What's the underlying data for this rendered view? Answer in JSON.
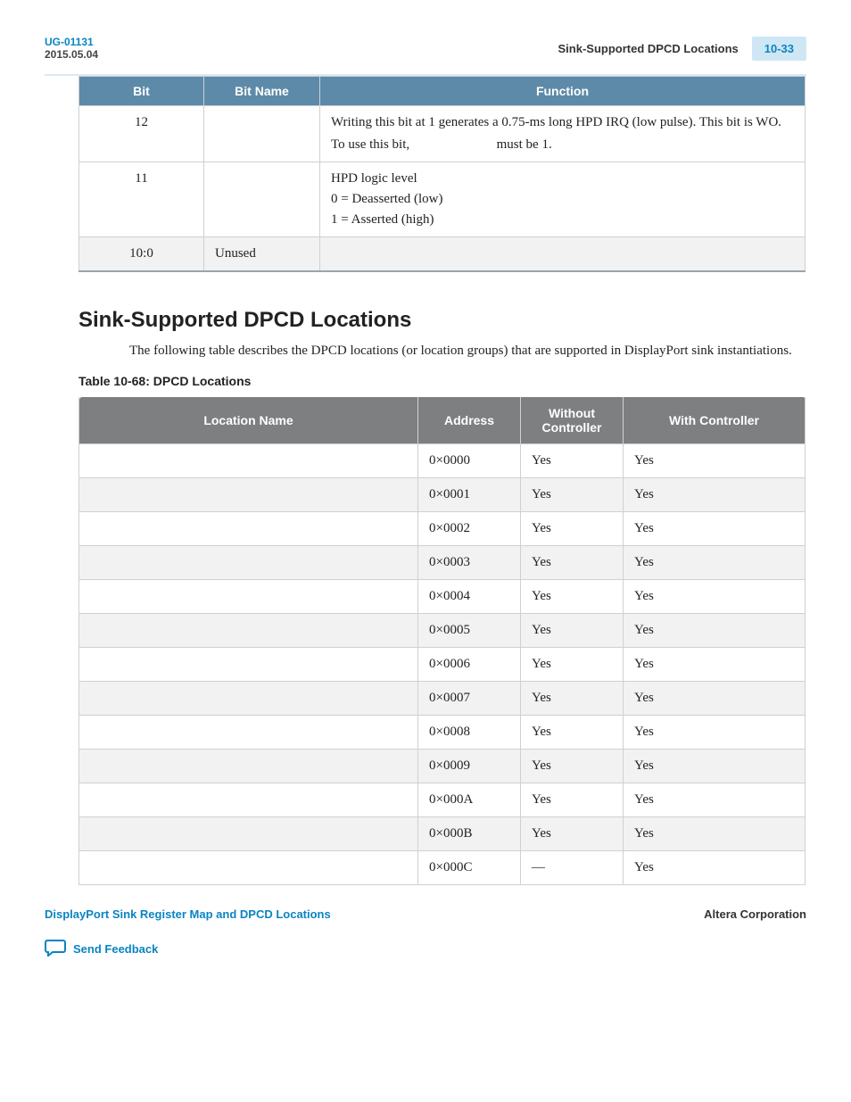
{
  "header": {
    "doc_id": "UG-01131",
    "doc_date": "2015.05.04",
    "section_title": "Sink-Supported DPCD Locations",
    "page_num": "10-33"
  },
  "table1": {
    "headers": {
      "c1": "Bit",
      "c2": "Bit Name",
      "c3": "Function"
    },
    "rows": [
      {
        "bit": "12",
        "name": "",
        "fn_l1": "Writing this bit at 1 generates a 0.75-ms long HPD IRQ (low pulse). This bit is WO.",
        "fn_l2a": "To use this bit,",
        "fn_l2b": "must be 1."
      },
      {
        "bit": "11",
        "name": "",
        "fn_l1": "HPD logic level",
        "fn_l2": "0 = Deasserted (low)",
        "fn_l3": "1 = Asserted (high)"
      },
      {
        "bit": "10:0",
        "name": "Unused",
        "fn": ""
      }
    ]
  },
  "section_heading": "Sink-Supported DPCD Locations",
  "intro_text": "The following table describes the DPCD locations (or location groups) that are supported in DisplayPort sink instantiations.",
  "table2_caption": "Table 10-68: DPCD Locations",
  "table2": {
    "headers": {
      "c1": "Location Name",
      "c2": "Address",
      "c3": "Without Controller",
      "c4": "With Controller"
    },
    "rows": [
      {
        "name": "",
        "addr": "0×0000",
        "wo": "Yes",
        "wc": "Yes"
      },
      {
        "name": "",
        "addr": "0×0001",
        "wo": "Yes",
        "wc": "Yes"
      },
      {
        "name": "",
        "addr": "0×0002",
        "wo": "Yes",
        "wc": "Yes"
      },
      {
        "name": "",
        "addr": "0×0003",
        "wo": "Yes",
        "wc": "Yes"
      },
      {
        "name": "",
        "addr": "0×0004",
        "wo": "Yes",
        "wc": "Yes"
      },
      {
        "name": "",
        "addr": "0×0005",
        "wo": "Yes",
        "wc": "Yes"
      },
      {
        "name": "",
        "addr": "0×0006",
        "wo": "Yes",
        "wc": "Yes"
      },
      {
        "name": "",
        "addr": "0×0007",
        "wo": "Yes",
        "wc": "Yes"
      },
      {
        "name": "",
        "addr": "0×0008",
        "wo": "Yes",
        "wc": "Yes"
      },
      {
        "name": "",
        "addr": "0×0009",
        "wo": "Yes",
        "wc": "Yes"
      },
      {
        "name": "",
        "addr": "0×000A",
        "wo": "Yes",
        "wc": "Yes"
      },
      {
        "name": "",
        "addr": "0×000B",
        "wo": "Yes",
        "wc": "Yes"
      },
      {
        "name": "",
        "addr": "0×000C",
        "wo": "—",
        "wc": "Yes"
      }
    ]
  },
  "footer": {
    "left": "DisplayPort Sink Register Map and DPCD Locations",
    "right": "Altera Corporation",
    "feedback": "Send Feedback"
  }
}
